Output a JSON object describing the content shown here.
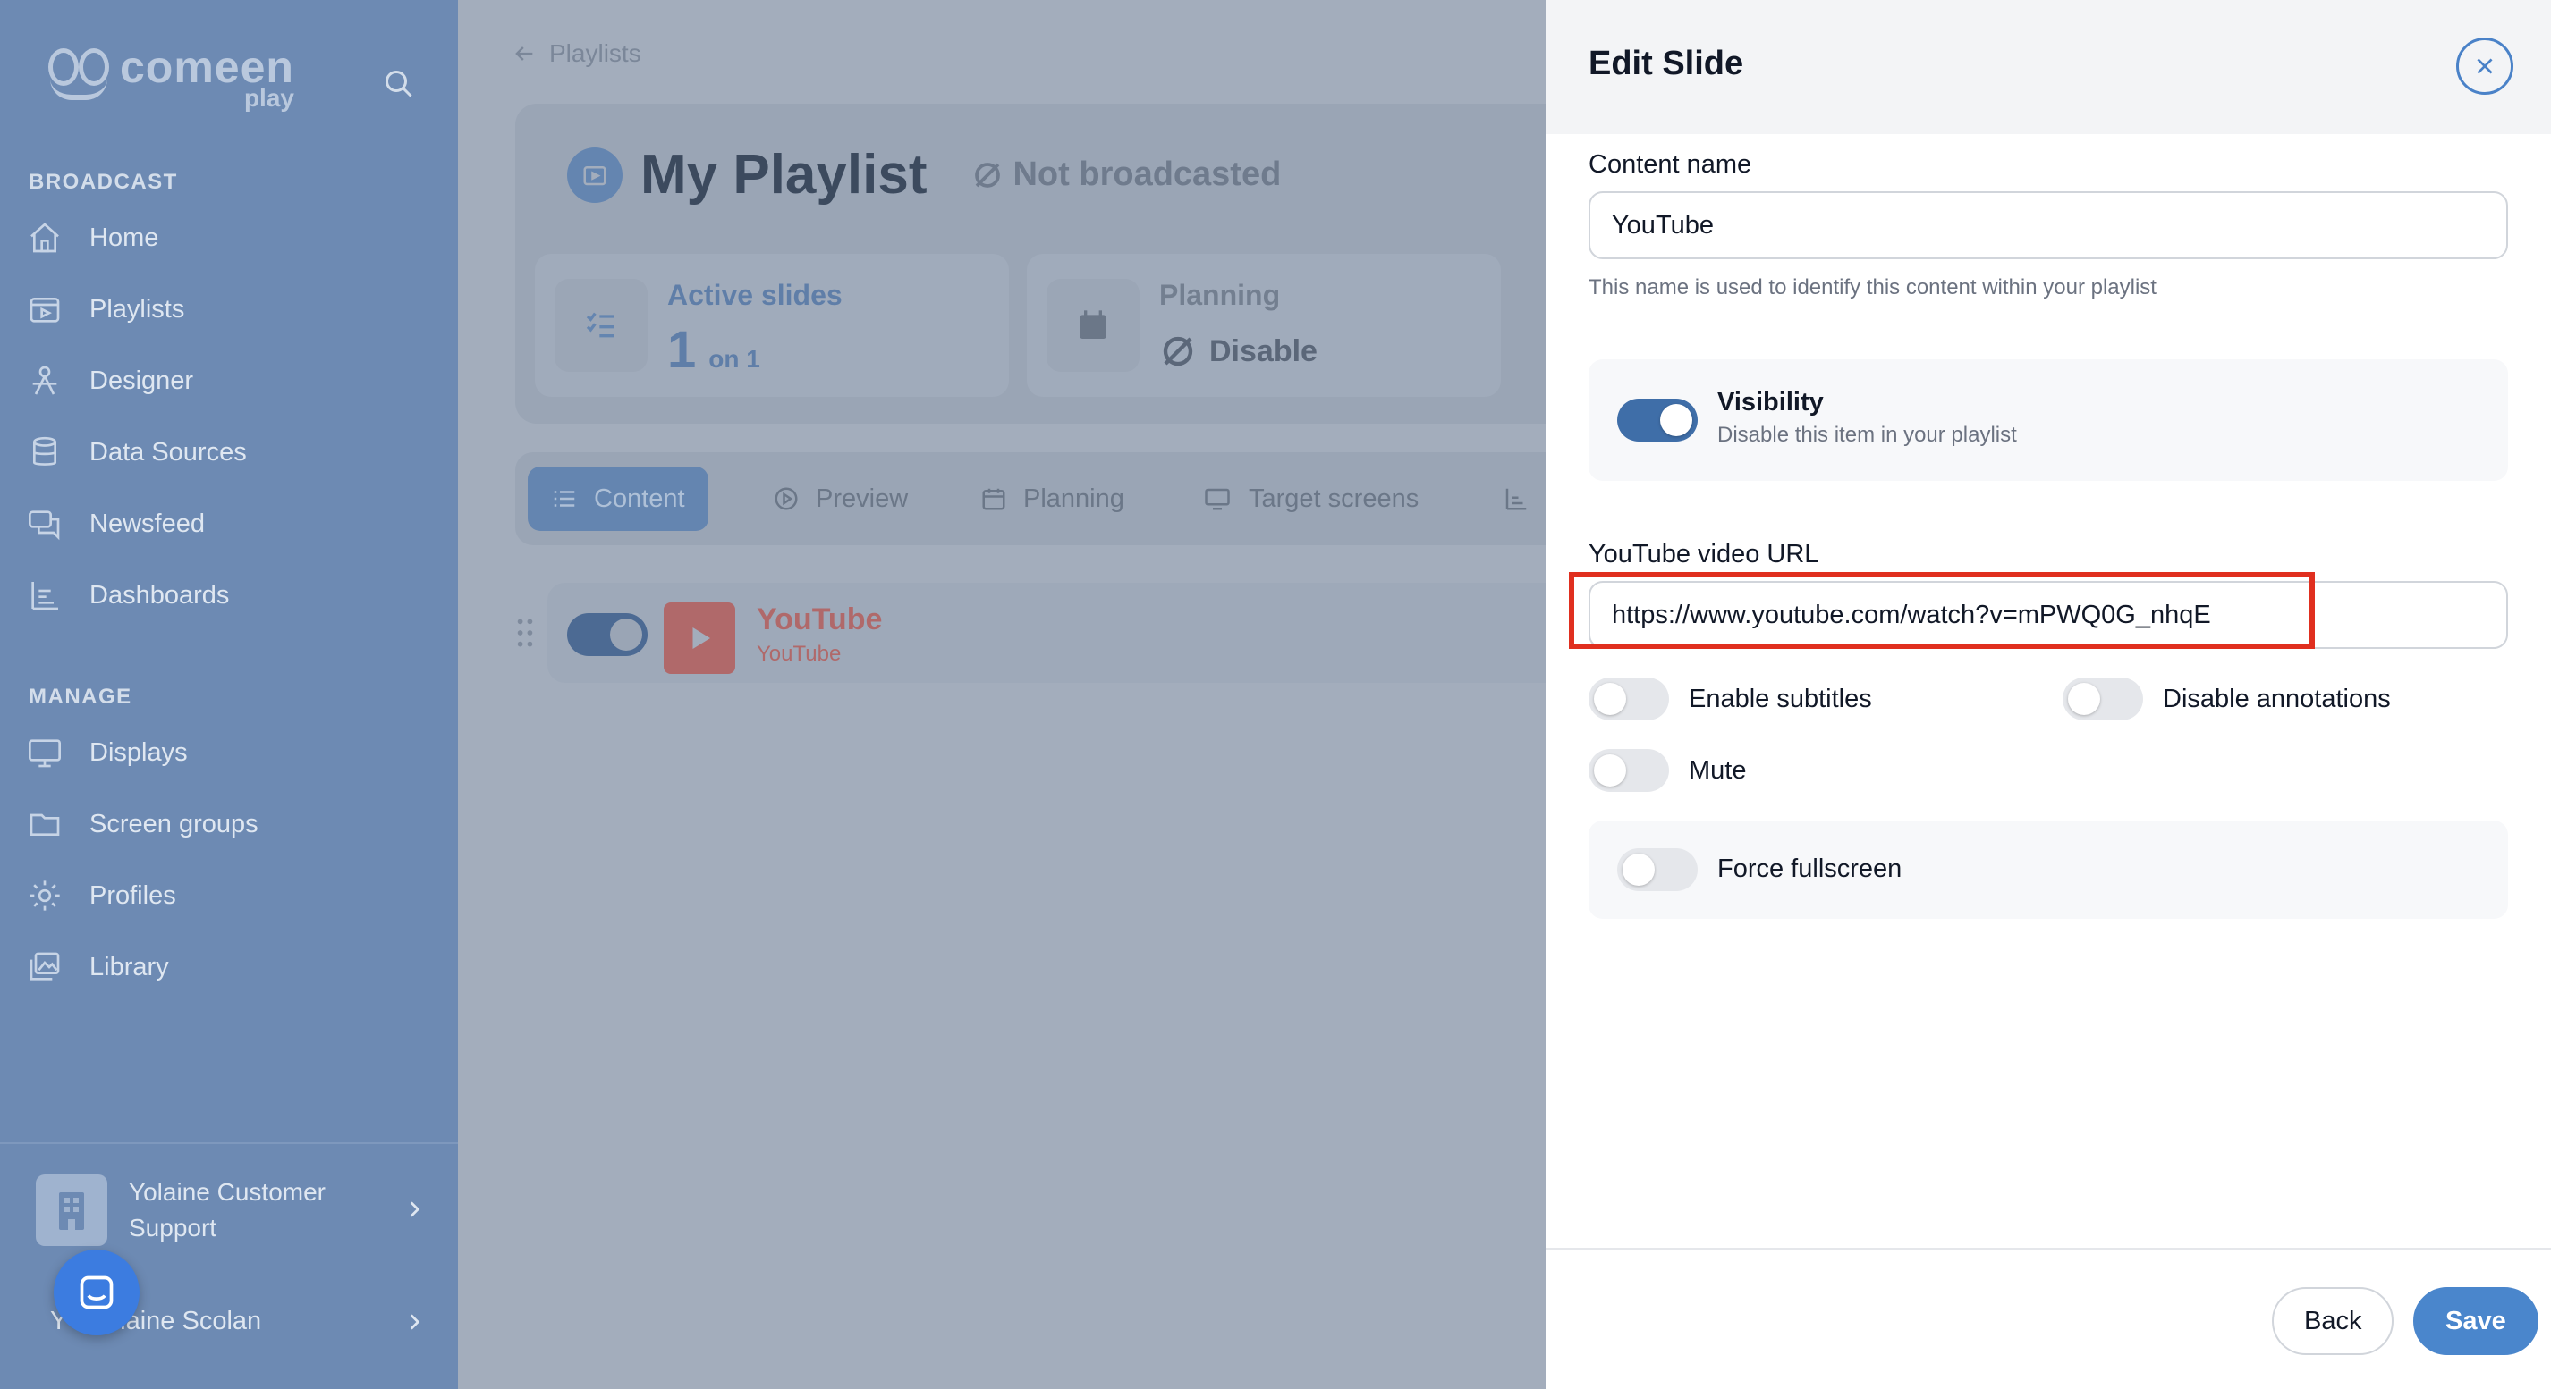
{
  "sidebar": {
    "logo": {
      "word": "comeen",
      "sub": "play"
    },
    "sections": {
      "broadcast": "BROADCAST",
      "manage": "MANAGE"
    },
    "broadcast_items": [
      {
        "label": "Home",
        "icon": "home-icon"
      },
      {
        "label": "Playlists",
        "icon": "playlist-icon"
      },
      {
        "label": "Designer",
        "icon": "designer-icon"
      },
      {
        "label": "Data Sources",
        "icon": "database-icon"
      },
      {
        "label": "Newsfeed",
        "icon": "newsfeed-icon"
      },
      {
        "label": "Dashboards",
        "icon": "dashboard-icon"
      }
    ],
    "manage_items": [
      {
        "label": "Displays",
        "icon": "display-icon"
      },
      {
        "label": "Screen groups",
        "icon": "folder-icon"
      },
      {
        "label": "Profiles",
        "icon": "gear-icon"
      },
      {
        "label": "Library",
        "icon": "image-library-icon"
      }
    ],
    "org_name": "Yolaine Customer Support",
    "user_initial": "Y",
    "user_name": "Yolaine Scolan"
  },
  "main": {
    "breadcrumb": "Playlists",
    "title": "My Playlist",
    "broadcast_status": "Not broadcasted",
    "stats": {
      "active": {
        "label": "Active slides",
        "value": "1",
        "sub": "on 1"
      },
      "planning": {
        "label": "Planning",
        "value": "Disable"
      }
    },
    "tabs": [
      "Content",
      "Preview",
      "Planning",
      "Target screens"
    ],
    "slide": {
      "title": "YouTube",
      "subtitle": "YouTube"
    }
  },
  "drawer": {
    "title": "Edit Slide",
    "content_name_label": "Content name",
    "content_name_value": "YouTube",
    "content_name_hint": "This name is used to identify this content within your playlist",
    "visibility": {
      "label": "Visibility",
      "sub": "Disable this item in your playlist",
      "on": true
    },
    "url_label": "YouTube video URL",
    "url_value": "https://www.youtube.com/watch?v=mPWQ0G_nhqE",
    "options": {
      "subtitles": "Enable subtitles",
      "annotations": "Disable annotations",
      "mute": "Mute",
      "fullscreen": "Force fullscreen"
    },
    "buttons": {
      "back": "Back",
      "save": "Save"
    }
  },
  "colors": {
    "sidebar": "#6d8ab3",
    "accent": "#4a86cc",
    "toggle_on": "#3f6ea8",
    "highlight": "#e02f1f",
    "youtube_dim": "#b0696a"
  }
}
